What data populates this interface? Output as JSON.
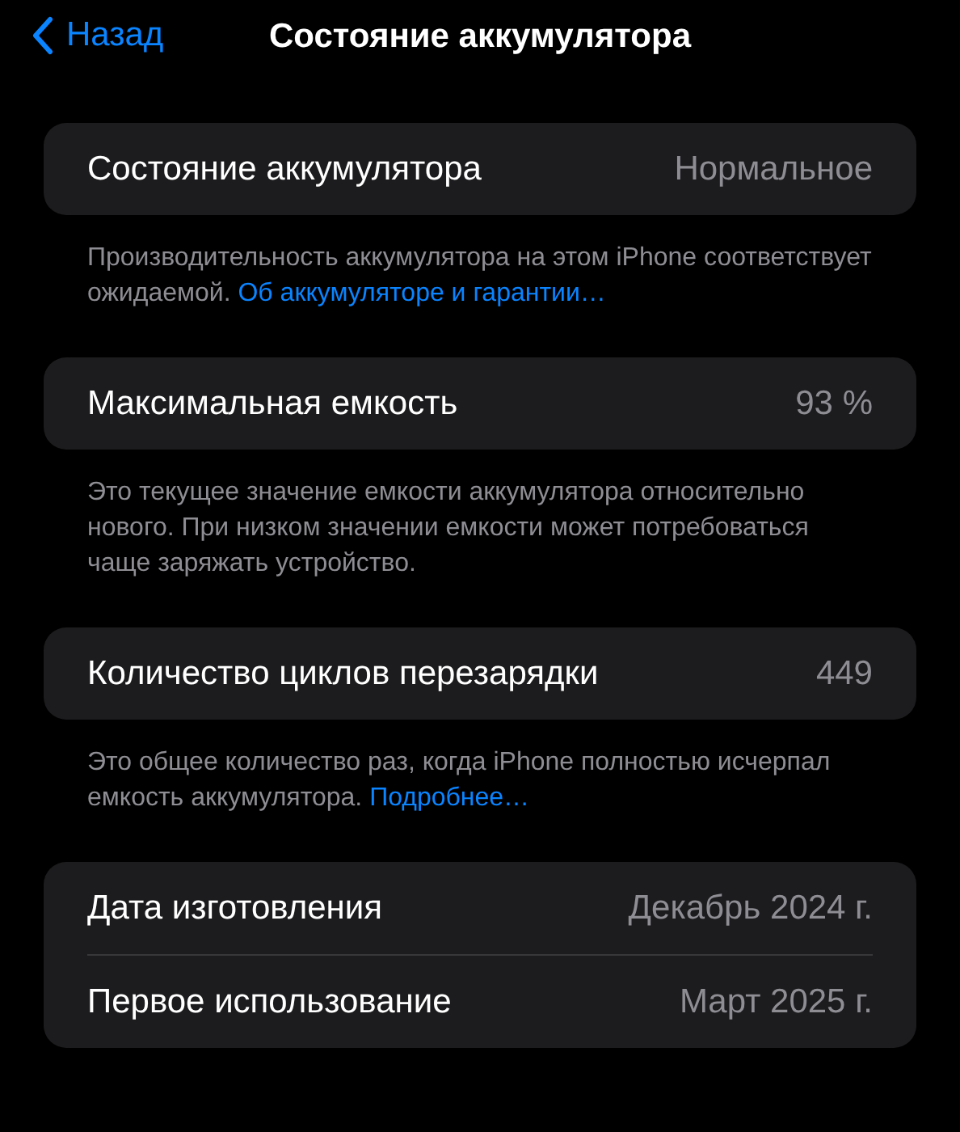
{
  "nav": {
    "back": "Назад",
    "title": "Состояние аккумулятора"
  },
  "sections": [
    {
      "rows": [
        {
          "label": "Состояние аккумулятора",
          "value": "Нормальное"
        }
      ],
      "footer": {
        "text": "Производительность аккумулятора на этом iPhone соответствует ожидаемой.",
        "link": "Об аккумуляторе и гарантии…"
      }
    },
    {
      "rows": [
        {
          "label": "Максимальная емкость",
          "value": "93 %"
        }
      ],
      "footer": {
        "text": "Это текущее значение емкости аккумулятора относительно нового. При низком значении емкости может потребоваться чаще заряжать устройство."
      }
    },
    {
      "rows": [
        {
          "label": "Количество циклов перезарядки",
          "value": "449"
        }
      ],
      "footer": {
        "text": "Это общее количество раз, когда iPhone полностью исчерпал емкость аккумулятора.",
        "link": "Подробнее…"
      }
    },
    {
      "rows": [
        {
          "label": "Дата изготовления",
          "value": "Декабрь 2024 г."
        },
        {
          "label": "Первое использование",
          "value": "Март 2025 г."
        }
      ]
    }
  ]
}
